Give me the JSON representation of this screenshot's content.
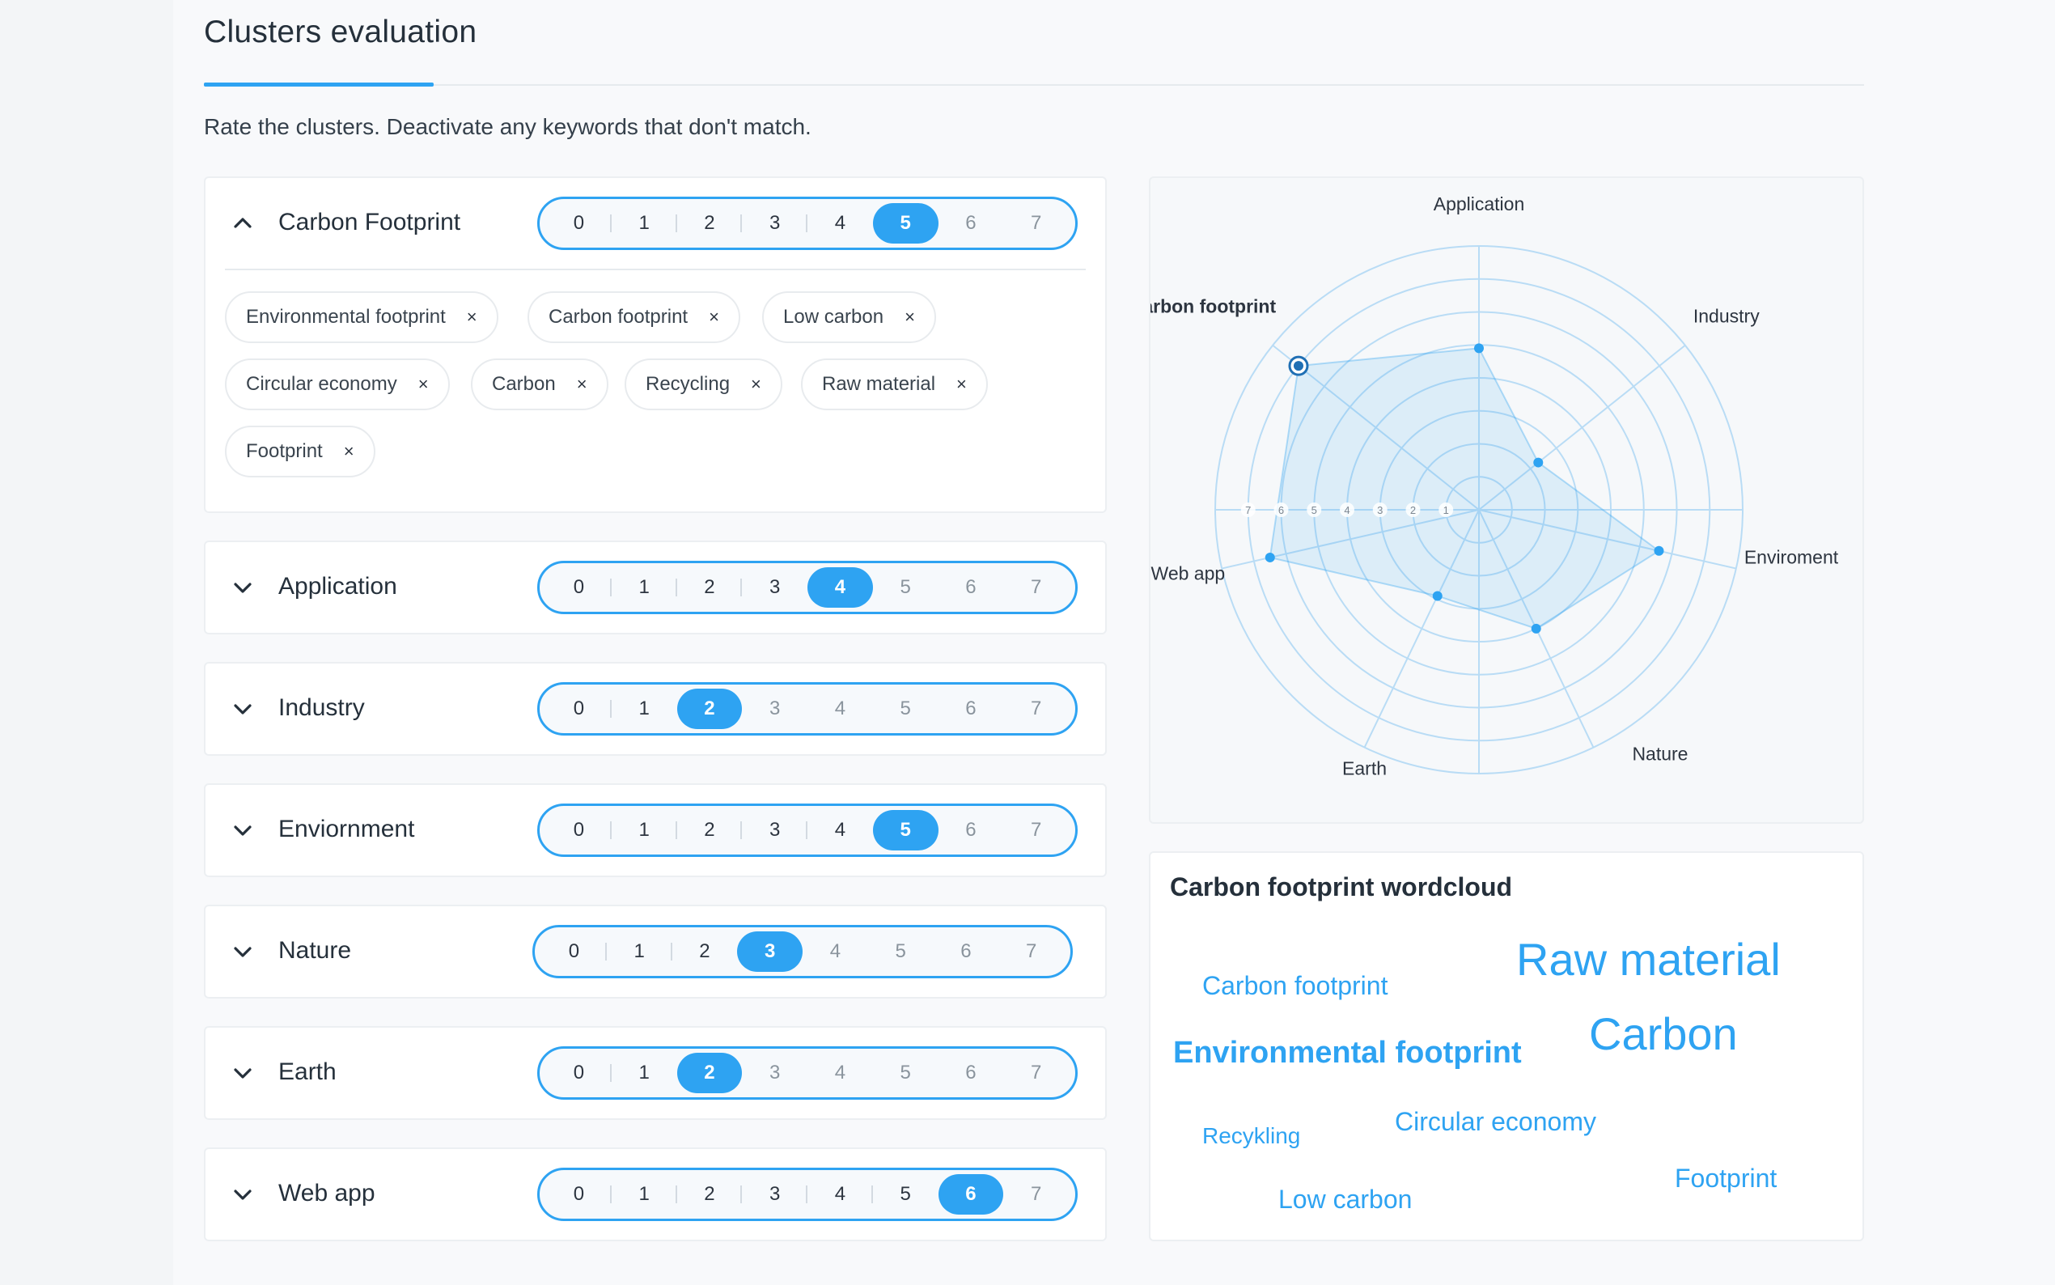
{
  "header": {
    "title": "Clusters evaluation",
    "subtitle": "Rate the clusters. Deactivate any keywords that don't match."
  },
  "rating_scale": [
    "0",
    "1",
    "2",
    "3",
    "4",
    "5",
    "6",
    "7"
  ],
  "clusters": [
    {
      "name": "Carbon Footprint",
      "rating": 5,
      "expanded": true,
      "keywords": [
        "Environmental footprint",
        "Carbon footprint",
        "Low carbon",
        "Circular economy",
        "Carbon",
        "Recycling",
        "Raw material",
        "Footprint"
      ]
    },
    {
      "name": "Application",
      "rating": 4,
      "expanded": false
    },
    {
      "name": "Industry",
      "rating": 2,
      "expanded": false
    },
    {
      "name": "Enviornment",
      "rating": 5,
      "expanded": false
    },
    {
      "name": "Nature",
      "rating": 3,
      "expanded": false
    },
    {
      "name": "Earth",
      "rating": 2,
      "expanded": false
    },
    {
      "name": "Web app",
      "rating": 6,
      "expanded": false
    }
  ],
  "chip_close_glyph": "×",
  "chart_data": {
    "type": "radar",
    "axes": [
      "Application",
      "Industry",
      "Enviroment",
      "Nature",
      "Earth",
      "Web app",
      "Carbon footprint"
    ],
    "values": [
      4.9,
      2.3,
      5.6,
      4.0,
      2.9,
      6.5,
      7.0
    ],
    "highlighted_axis": "Carbon footprint",
    "rlim": [
      0,
      8
    ],
    "tick_labels": [
      "1",
      "2",
      "3",
      "4",
      "5",
      "6",
      "7"
    ],
    "color": "#2ea3f2"
  },
  "wordcloud": {
    "title": "Carbon footprint wordcloud",
    "words": [
      {
        "text": "Carbon footprint",
        "weight": 2
      },
      {
        "text": "Raw material",
        "weight": 4
      },
      {
        "text": "Environmental footprint",
        "weight": 3
      },
      {
        "text": "Carbon",
        "weight": 4
      },
      {
        "text": "Recykling",
        "weight": 1
      },
      {
        "text": "Circular economy",
        "weight": 2
      },
      {
        "text": "Low carbon",
        "weight": 2
      },
      {
        "text": "Footprint",
        "weight": 2
      }
    ]
  },
  "colors": {
    "accent": "#2ea3f2",
    "text": "#25303b",
    "muted": "#8a949d"
  }
}
